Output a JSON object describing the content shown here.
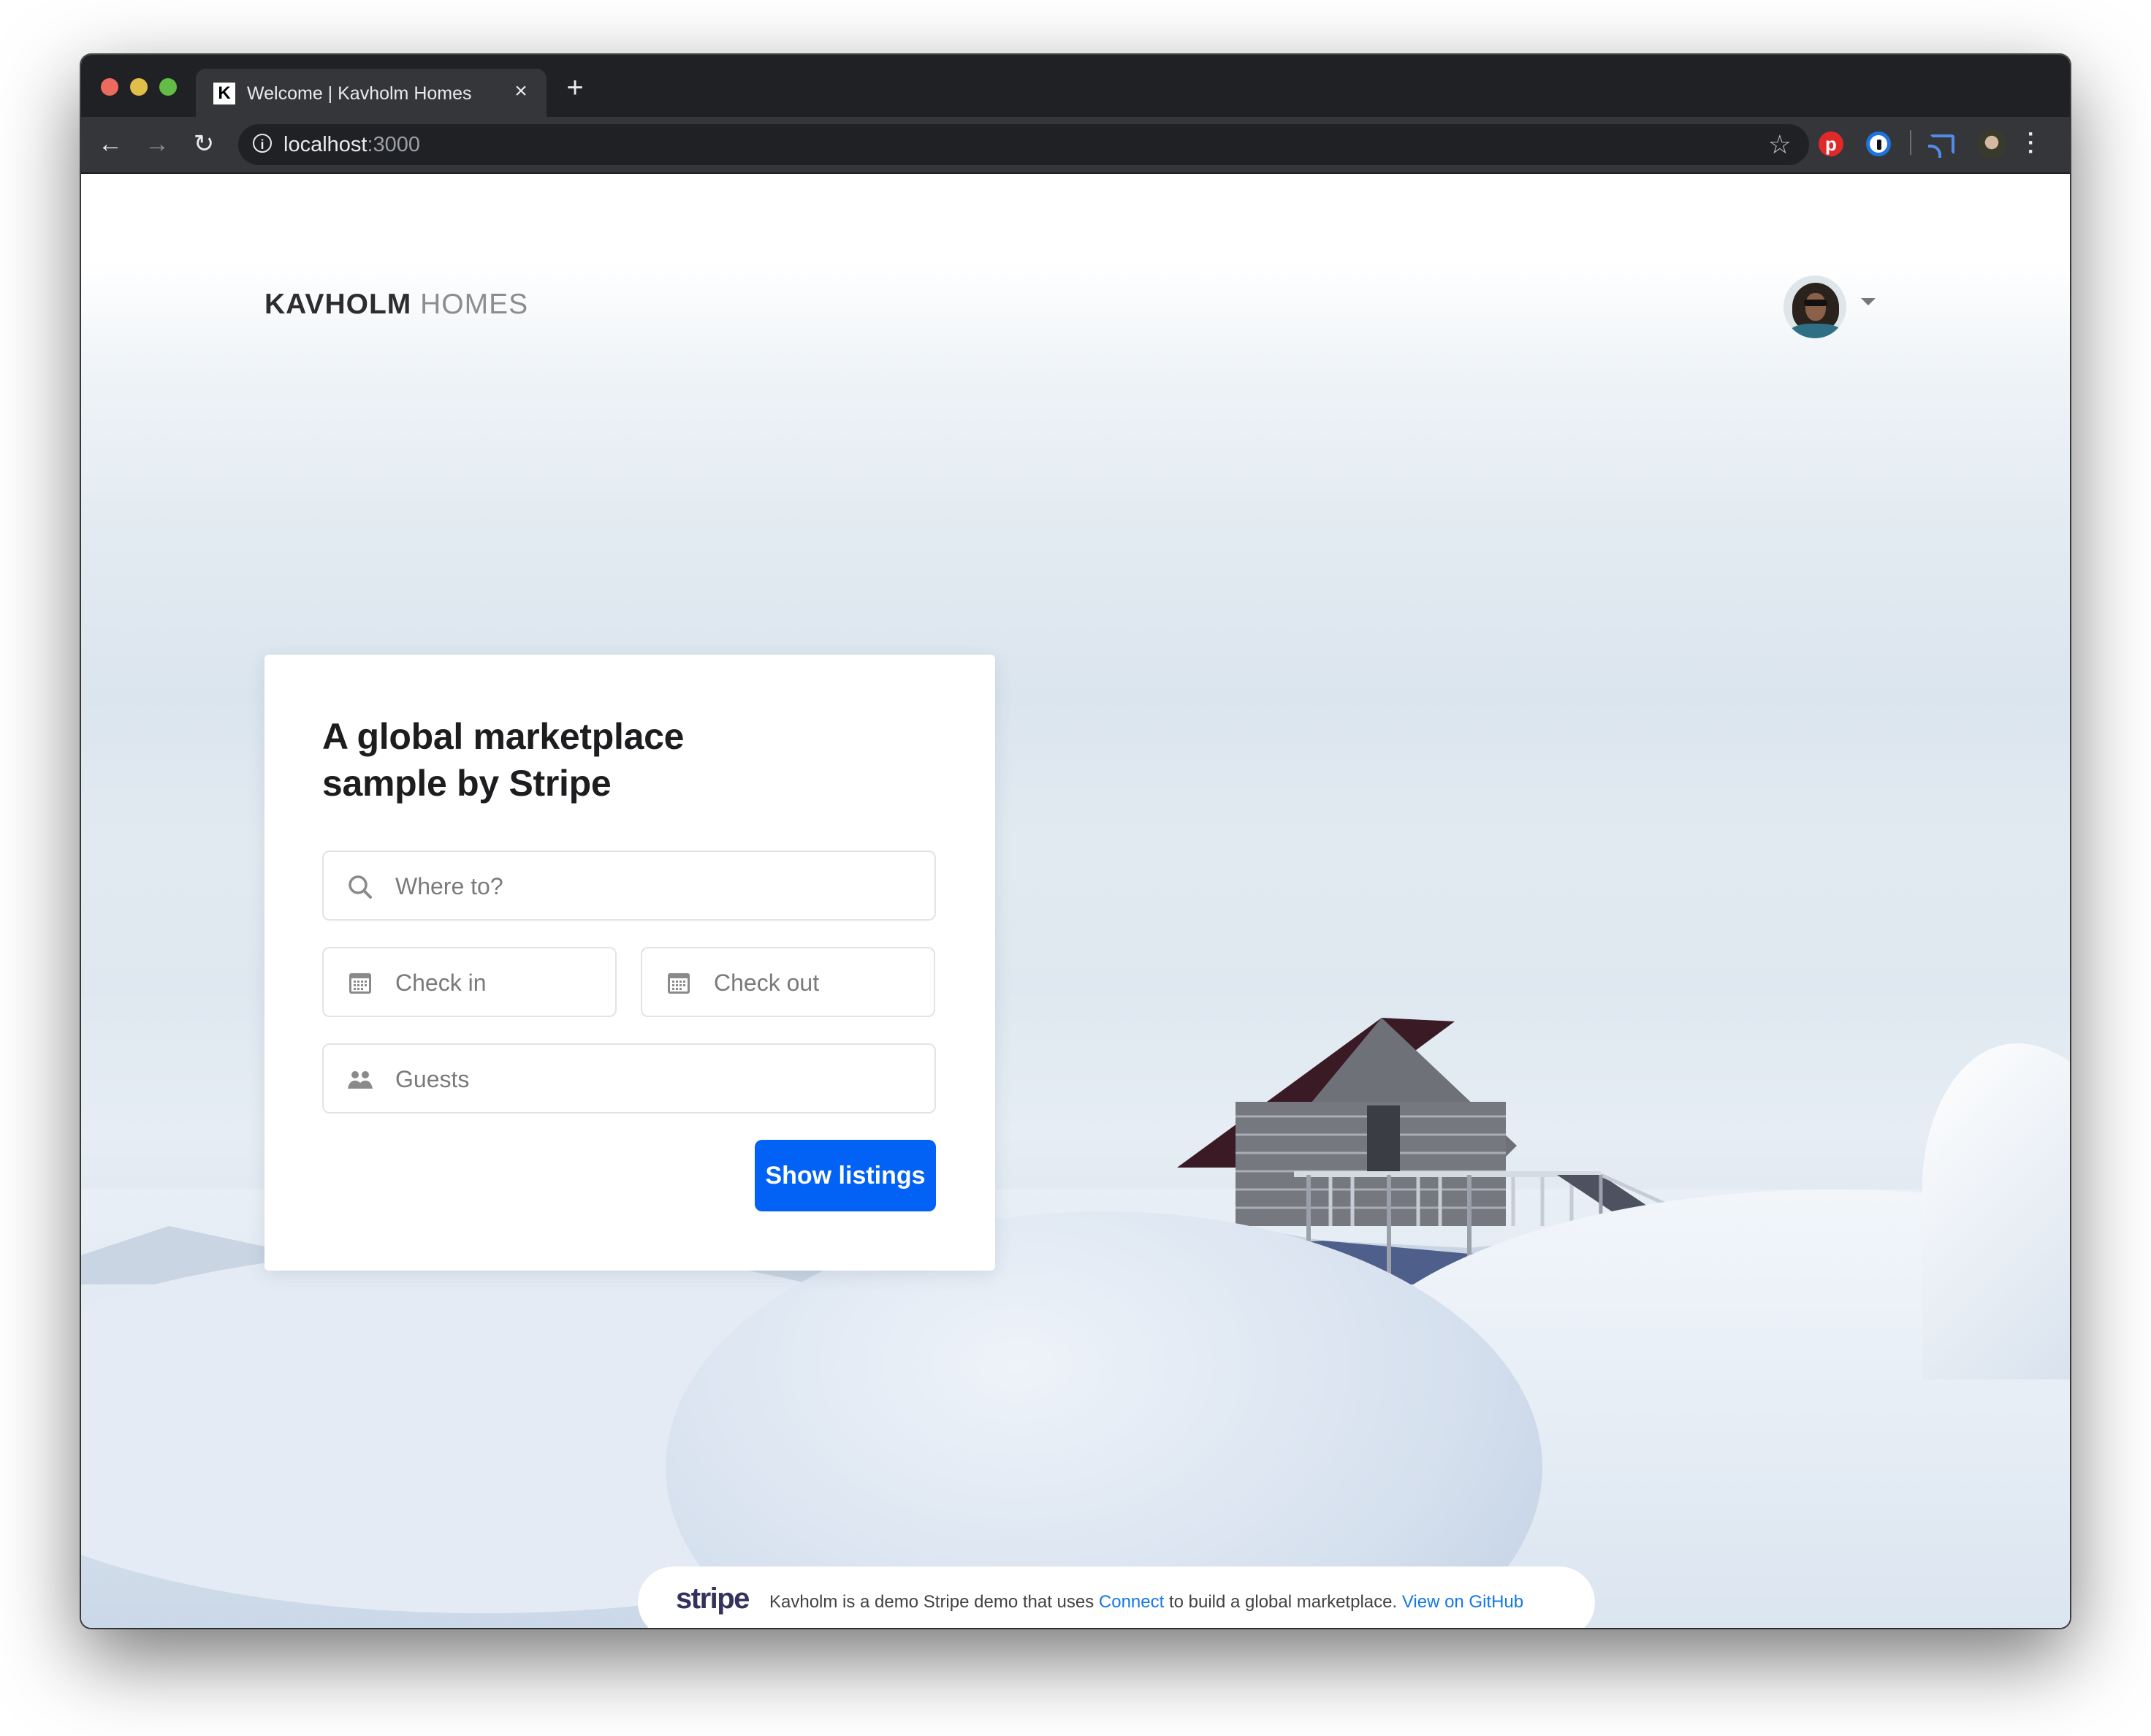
{
  "browser": {
    "tab": {
      "favicon_letter": "K",
      "title": "Welcome | Kavholm Homes",
      "close_glyph": "×"
    },
    "new_tab_glyph": "+",
    "nav": {
      "back_glyph": "←",
      "forward_glyph": "→",
      "reload_glyph": "↻"
    },
    "url": {
      "host": "localhost",
      "port": ":3000"
    },
    "star_glyph": "☆",
    "extensions": [
      "pinterest-icon",
      "1password-icon",
      "cast-icon"
    ],
    "menu_glyph": "⋮"
  },
  "header": {
    "logo_primary": "KAVHOLM",
    "logo_secondary": "HOMES"
  },
  "search_card": {
    "title_line1": "A global marketplace",
    "title_line2": "sample by Stripe",
    "where_placeholder": "Where to?",
    "checkin_placeholder": "Check in",
    "checkout_placeholder": "Check out",
    "guests_placeholder": "Guests",
    "submit_label": "Show listings"
  },
  "footer": {
    "brand": "stripe",
    "text_before": "Kavholm is a demo Stripe demo that uses ",
    "connect_link": "Connect",
    "text_after": " to build a global marketplace. ",
    "github_link": "View on GitHub"
  },
  "colors": {
    "primary_button": "#0262f5",
    "link": "#1478e6",
    "stripe_brand": "#32325d",
    "browser_chrome": "#202124"
  }
}
